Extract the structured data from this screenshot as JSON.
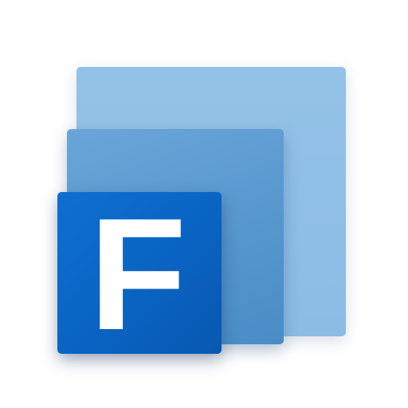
{
  "app_icon": {
    "letter": "F",
    "colors": {
      "back_tile": "#8ebee5",
      "middle_tile": "#5596cd",
      "front_tile": "#0a63c2",
      "letter": "#ffffff",
      "background": "#ffffff"
    }
  }
}
